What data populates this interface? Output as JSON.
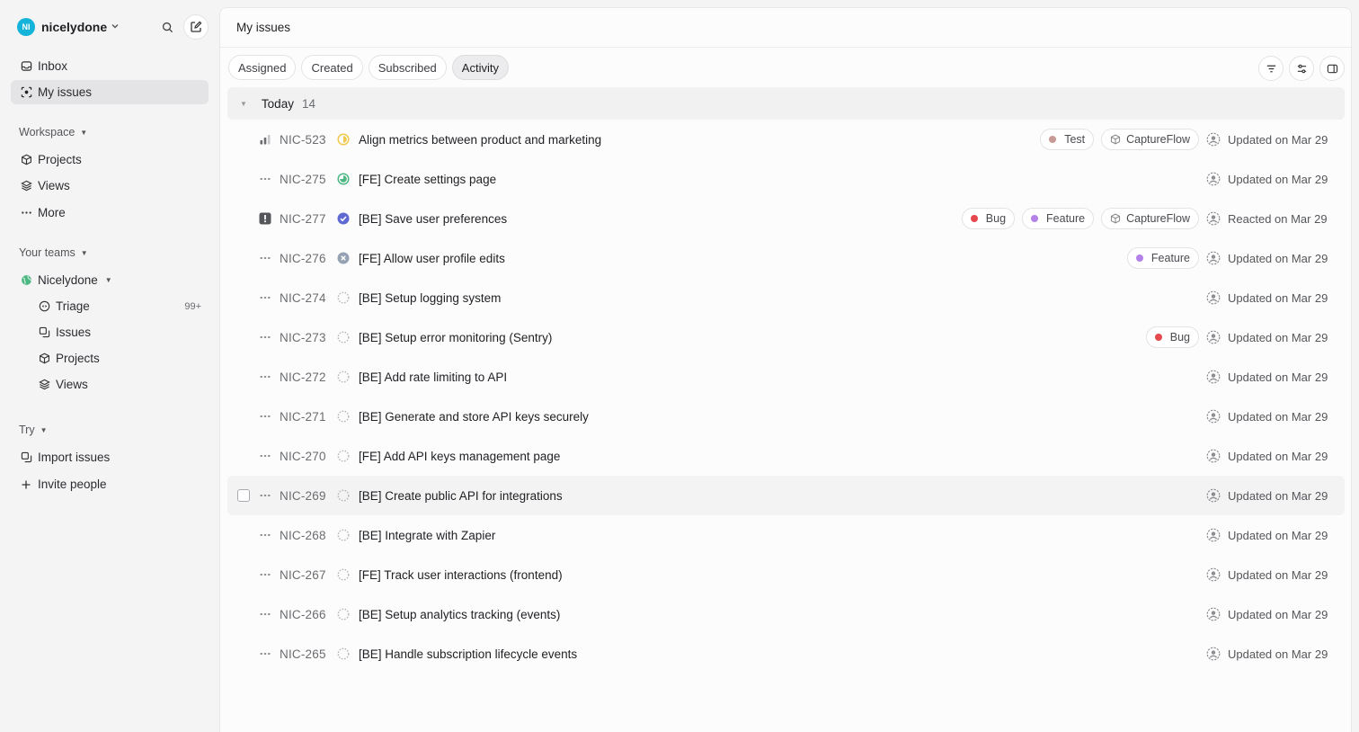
{
  "workspace": {
    "initials": "NI",
    "name": "nicelydone"
  },
  "nav": {
    "inbox": "Inbox",
    "my_issues": "My issues"
  },
  "workspace_section": {
    "title": "Workspace",
    "items": [
      "Projects",
      "Views",
      "More"
    ]
  },
  "teams_section": {
    "title": "Your teams",
    "team_name": "Nicelydone",
    "items": [
      {
        "label": "Triage",
        "badge": "99+"
      },
      {
        "label": "Issues"
      },
      {
        "label": "Projects"
      },
      {
        "label": "Views"
      }
    ]
  },
  "try_section": {
    "title": "Try",
    "items": [
      "Import issues",
      "Invite people"
    ]
  },
  "main": {
    "title": "My issues",
    "tabs": [
      "Assigned",
      "Created",
      "Subscribed",
      "Activity"
    ],
    "active_tab": "Activity",
    "group": {
      "name": "Today",
      "count": "14"
    }
  },
  "issues": [
    {
      "id": "NIC-523",
      "title": "Align metrics between product and marketing",
      "priority": "medium-bars",
      "status": "in-progress",
      "labels": [
        {
          "text": "Test",
          "color": "#c79a96"
        }
      ],
      "project": "CaptureFlow",
      "activity": "Updated on Mar 29"
    },
    {
      "id": "NIC-275",
      "title": "[FE] Create settings page",
      "priority": "none",
      "status": "in-review",
      "labels": [],
      "project": "",
      "activity": "Updated on Mar 29"
    },
    {
      "id": "NIC-277",
      "title": "[BE] Save user preferences",
      "priority": "urgent",
      "status": "done",
      "labels": [
        {
          "text": "Bug",
          "color": "#e5484d"
        },
        {
          "text": "Feature",
          "color": "#b381e8"
        }
      ],
      "project": "CaptureFlow",
      "activity": "Reacted on Mar 29"
    },
    {
      "id": "NIC-276",
      "title": "[FE] Allow user profile edits",
      "priority": "none",
      "status": "canceled",
      "labels": [
        {
          "text": "Feature",
          "color": "#b381e8"
        }
      ],
      "project": "",
      "activity": "Updated on Mar 29"
    },
    {
      "id": "NIC-274",
      "title": "[BE] Setup logging system",
      "priority": "none",
      "status": "backlog",
      "labels": [],
      "project": "",
      "activity": "Updated on Mar 29"
    },
    {
      "id": "NIC-273",
      "title": "[BE] Setup error monitoring (Sentry)",
      "priority": "none",
      "status": "backlog",
      "labels": [
        {
          "text": "Bug",
          "color": "#e5484d"
        }
      ],
      "project": "",
      "activity": "Updated on Mar 29"
    },
    {
      "id": "NIC-272",
      "title": "[BE] Add rate limiting to API",
      "priority": "none",
      "status": "backlog",
      "labels": [],
      "project": "",
      "activity": "Updated on Mar 29"
    },
    {
      "id": "NIC-271",
      "title": "[BE] Generate and store API keys securely",
      "priority": "none",
      "status": "backlog",
      "labels": [],
      "project": "",
      "activity": "Updated on Mar 29"
    },
    {
      "id": "NIC-270",
      "title": "[FE] Add API keys management page",
      "priority": "none",
      "status": "backlog",
      "labels": [],
      "project": "",
      "activity": "Updated on Mar 29"
    },
    {
      "id": "NIC-269",
      "title": "[BE] Create public API for integrations",
      "priority": "none",
      "status": "backlog",
      "labels": [],
      "project": "",
      "activity": "Updated on Mar 29",
      "hovered": true
    },
    {
      "id": "NIC-268",
      "title": "[BE] Integrate with Zapier",
      "priority": "none",
      "status": "backlog",
      "labels": [],
      "project": "",
      "activity": "Updated on Mar 29"
    },
    {
      "id": "NIC-267",
      "title": "[FE] Track user interactions (frontend)",
      "priority": "none",
      "status": "backlog",
      "labels": [],
      "project": "",
      "activity": "Updated on Mar 29"
    },
    {
      "id": "NIC-266",
      "title": "[BE] Setup analytics tracking (events)",
      "priority": "none",
      "status": "backlog",
      "labels": [],
      "project": "",
      "activity": "Updated on Mar 29"
    },
    {
      "id": "NIC-265",
      "title": "[BE] Handle subscription lifecycle events",
      "priority": "none",
      "status": "backlog",
      "labels": [],
      "project": "",
      "activity": "Updated on Mar 29"
    }
  ],
  "colors": {
    "accent": "#14b3d9",
    "done": "#5e6ad2",
    "in_review": "#4cb782",
    "in_progress": "#f2c94c",
    "canceled": "#95a2b3"
  }
}
